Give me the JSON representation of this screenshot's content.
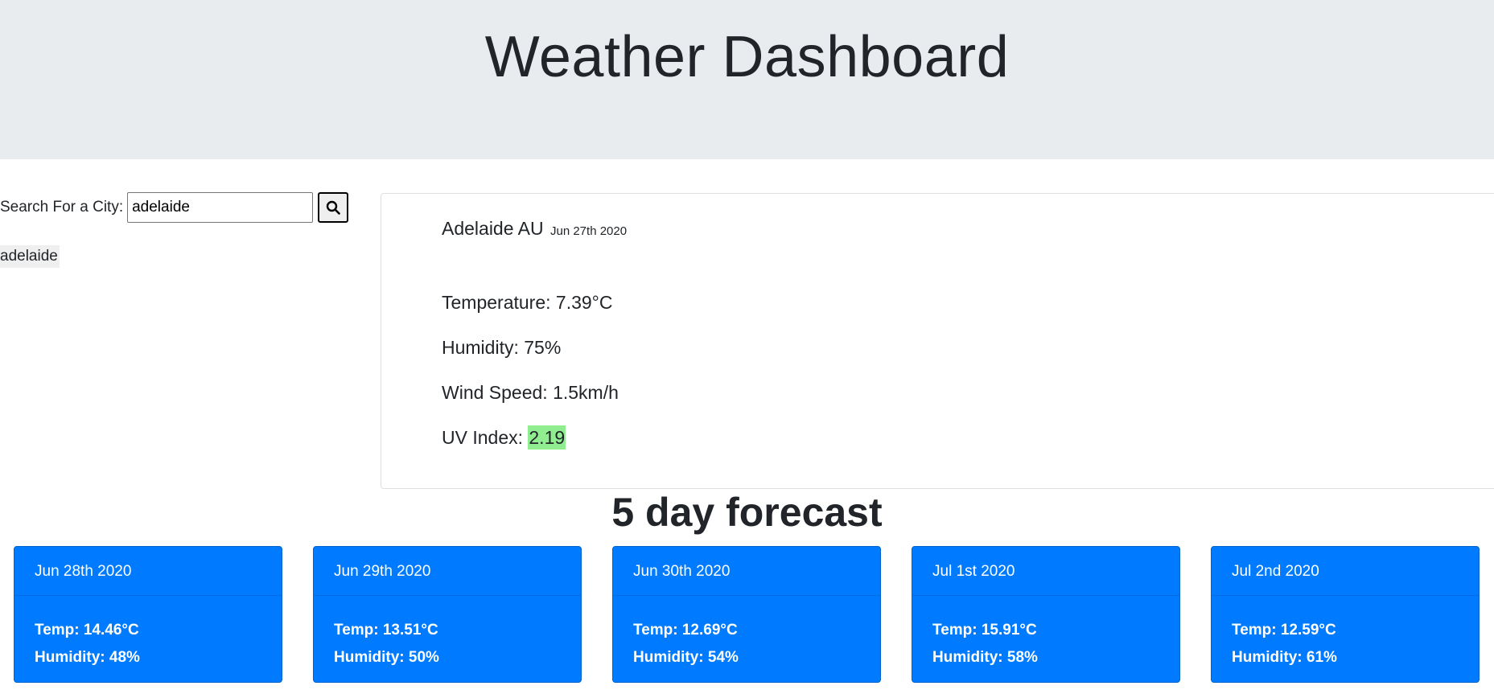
{
  "header": {
    "title": "Weather Dashboard"
  },
  "search": {
    "label": "Search For a City:",
    "value": "adelaide",
    "button_icon": "search-icon"
  },
  "history": [
    "adelaide"
  ],
  "current": {
    "city": "Adelaide AU",
    "date": "Jun 27th 2020",
    "temperature": "Temperature: 7.39°C",
    "humidity": "Humidity: 75%",
    "wind": "Wind Speed: 1.5km/h",
    "uv_label": "UV Index:",
    "uv_value": "2.19",
    "uv_color": "#90ee90"
  },
  "forecast": {
    "title": "5 day forecast",
    "accent": "#007bff",
    "days": [
      {
        "date": "Jun 28th 2020",
        "temp": "Temp: 14.46°C",
        "humidity": "Humidity: 48%"
      },
      {
        "date": "Jun 29th 2020",
        "temp": "Temp: 13.51°C",
        "humidity": "Humidity: 50%"
      },
      {
        "date": "Jun 30th 2020",
        "temp": "Temp: 12.69°C",
        "humidity": "Humidity: 54%"
      },
      {
        "date": "Jul 1st 2020",
        "temp": "Temp: 15.91°C",
        "humidity": "Humidity: 58%"
      },
      {
        "date": "Jul 2nd 2020",
        "temp": "Temp: 12.59°C",
        "humidity": "Humidity: 61%"
      }
    ]
  }
}
